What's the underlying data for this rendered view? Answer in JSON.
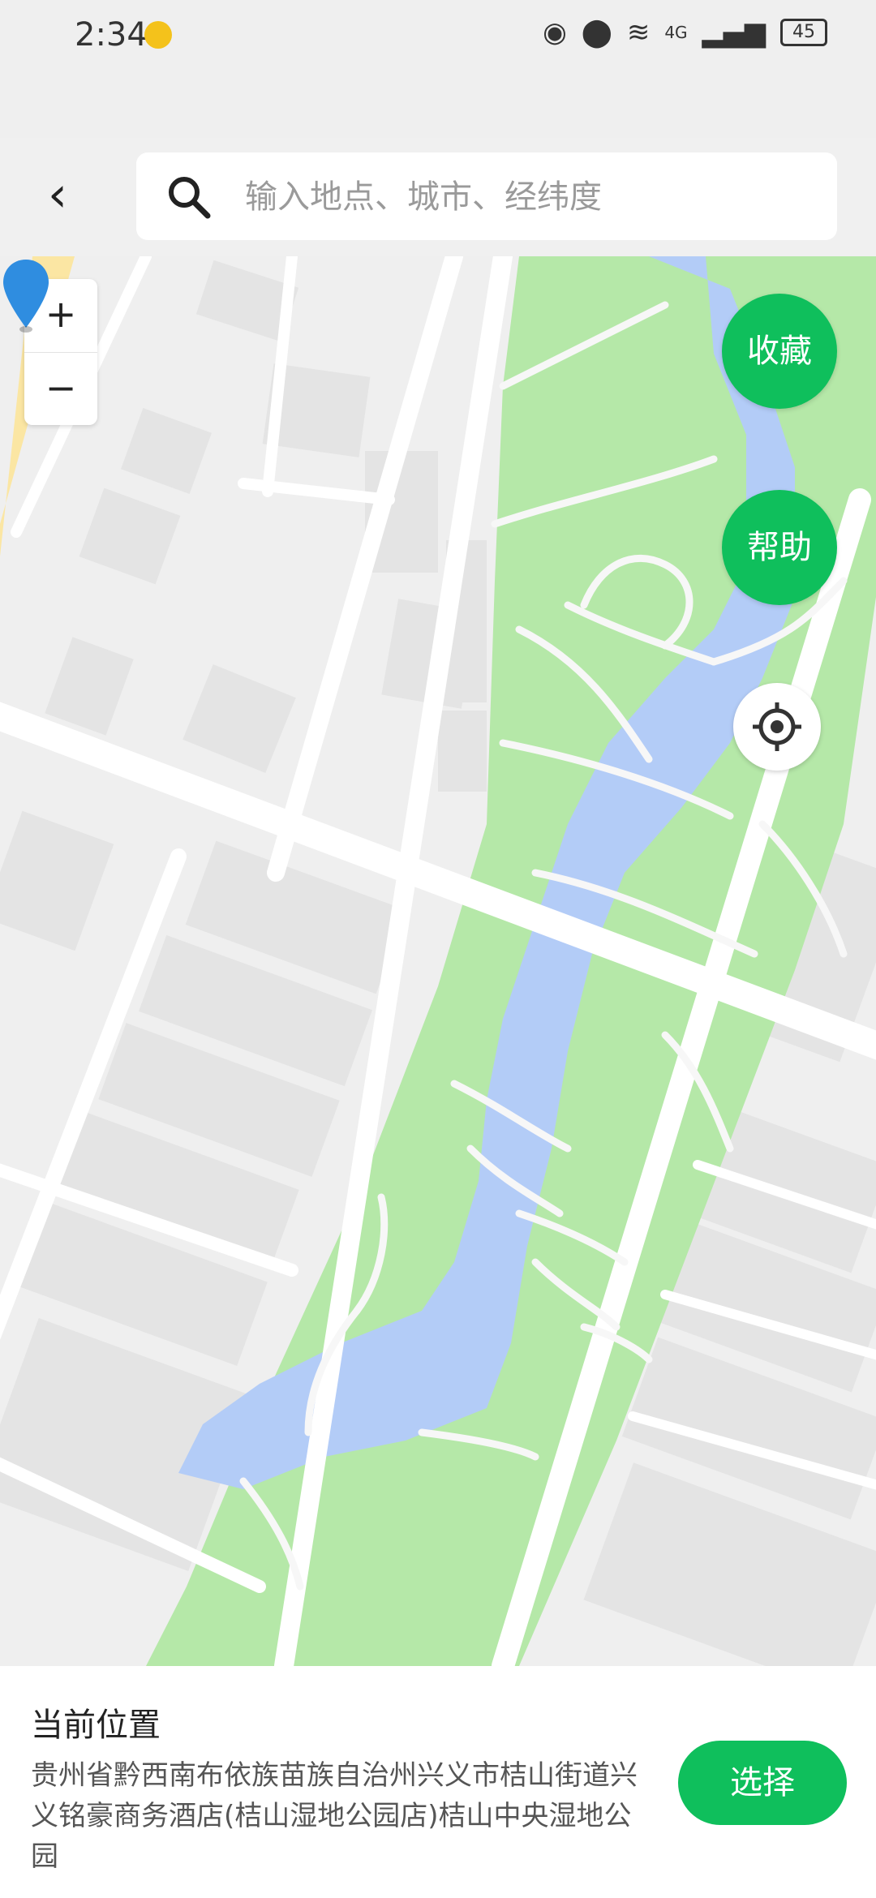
{
  "status_bar": {
    "time": "2:34",
    "network": "4G",
    "battery": "45"
  },
  "header": {
    "back_icon": "chevron-left-icon",
    "search_placeholder": "输入地点、城市、经纬度",
    "search_value": ""
  },
  "map": {
    "zoom_in": "+",
    "zoom_out": "−",
    "favorite_label": "收藏",
    "help_label": "帮助",
    "colors": {
      "park": "#b5e8a8",
      "water": "#b3ccf7",
      "road": "#ffffff",
      "block": "#e7e7e7",
      "accent": "#0fbf5c",
      "pin": "#2f8de0"
    }
  },
  "bottom": {
    "title": "当前位置",
    "address": "贵州省黔西南布依族苗族自治州兴义市桔山街道兴义铭豪商务酒店(桔山湿地公园店)桔山中央湿地公园",
    "select_label": "选择"
  }
}
